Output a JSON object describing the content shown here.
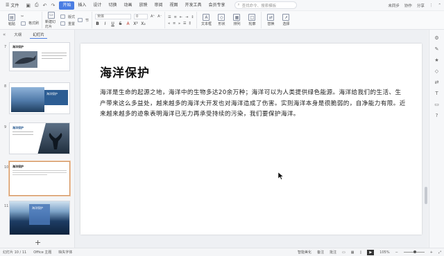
{
  "menu": {
    "file_label": "文件",
    "tabs": [
      "开始",
      "插入",
      "设计",
      "切换",
      "动画",
      "放映",
      "审阅",
      "视图",
      "开发工具",
      "会员专享"
    ],
    "active_tab_index": 0,
    "search_placeholder": "查找命令、搜索模板",
    "right_items": [
      "未同步",
      "协作",
      "分享"
    ]
  },
  "ribbon": {
    "paste_label": "粘贴",
    "format_painter": "格式刷",
    "new_slide": "新建幻灯片",
    "layout": "版式",
    "section": "节",
    "reset": "重置",
    "font_name": "宋体",
    "font_size": "0",
    "text_box": "文本框",
    "shape": "形状",
    "arrange": "排列",
    "outline": "轮廓",
    "replace": "替换",
    "select": "选择",
    "format_buttons": [
      "B",
      "I",
      "U",
      "S",
      "A",
      "X²",
      "X₂"
    ]
  },
  "left_panel": {
    "tabs": [
      "大纲",
      "幻灯片"
    ],
    "active_tab_index": 1,
    "slides": [
      {
        "num": "7",
        "title": "海洋保护",
        "variant": "whale"
      },
      {
        "num": "8",
        "title": "海洋保护",
        "variant": "coast"
      },
      {
        "num": "9",
        "title": "海洋保护",
        "variant": "tail"
      },
      {
        "num": "10",
        "title": "海洋保护",
        "variant": "text"
      },
      {
        "num": "11",
        "title": "海洋保护",
        "variant": "sea"
      }
    ],
    "selected_index": 3
  },
  "slide": {
    "title": "海洋保护",
    "body": "海洋是生命的起源之地，海洋中的生物多达20余万种；海洋可以为人类提供绿色能源。海洋给我们的生活、生产带来这么多益处，越来越多的海洋大开发也对海洋造成了伤害。实则海洋本身是很脆弱的，自净能力有限。近来越来越多的迹象表明海洋已无力再承受持续的污染，我们要保护海洋。"
  },
  "status": {
    "slide_info": "幻灯片 10 / 11",
    "theme": "Office 主题",
    "missing_font": "缺失字体",
    "smart_beautify": "智能美化",
    "notes": "备注",
    "comments": "批注",
    "zoom": "105%"
  },
  "colors": {
    "accent": "#4a7de3",
    "selected_thumb": "#d39561"
  }
}
